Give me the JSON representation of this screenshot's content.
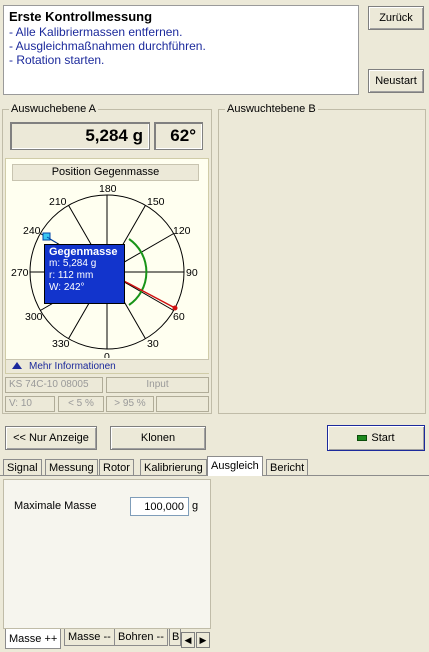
{
  "instructions": {
    "title": "Erste Kontrollmessung",
    "lines": [
      "- Alle Kalibriermassen entfernen.",
      "- Ausgleichmaßnahmen durchführen.",
      "- Rotation starten."
    ]
  },
  "buttons": {
    "back": "Zurück",
    "restart": "Neustart",
    "display_only": "<< Nur Anzeige",
    "clone": "Klonen",
    "start": "Start"
  },
  "plane_a": {
    "legend": "Auswuchebene A",
    "mass": "5,284 g",
    "angle": "62°",
    "position_label": "Position Gegenmasse",
    "dial_labels": [
      "180",
      "150",
      "120",
      "90",
      "60",
      "30",
      "0",
      "330",
      "300",
      "270",
      "240",
      "210"
    ],
    "info": {
      "title": "Gegenmasse",
      "m": "m: 5,284 g",
      "r": "r: 112 mm",
      "w": "W: 242°"
    },
    "more_info": "Mehr Informationen",
    "status": {
      "sensor": "KS 74C-10 08005",
      "input": "Input",
      "v": "V: 10",
      "lt": "< 5 %",
      "gt": "> 95 %"
    }
  },
  "plane_b": {
    "legend": "Auswuchtebene B"
  },
  "tabs": [
    "Signal",
    "Messung",
    "Rotor",
    "Kalibrierung",
    "Ausgleich",
    "Bericht"
  ],
  "active_tab": "Ausgleich",
  "balance": {
    "max_mass_label": "Maximale Masse",
    "max_mass_value": "100,000",
    "unit": "g"
  },
  "bottom_tabs": [
    "Masse ++",
    "Masse --",
    "Bohren --",
    "B"
  ],
  "colors": {
    "instr_text": "#1c2a9c",
    "info_bg": "#1234cc",
    "start_led": "#1e8a1e"
  }
}
